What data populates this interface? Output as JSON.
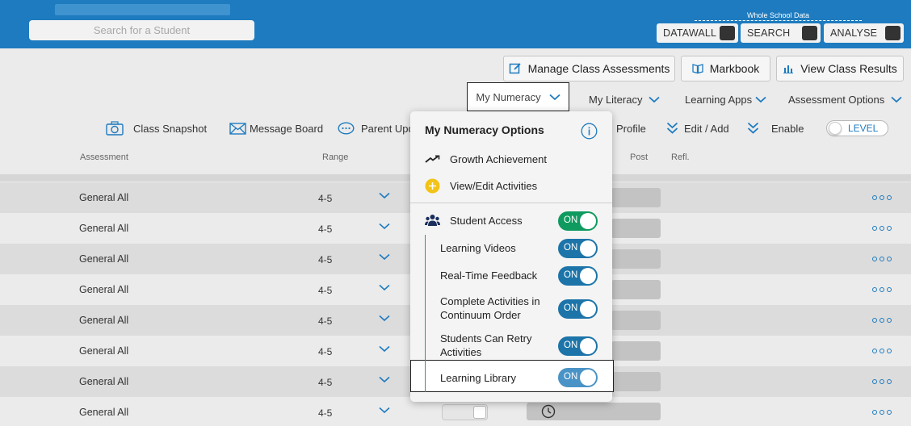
{
  "header": {
    "search_placeholder": "Search for a Student",
    "whole_school_label": "Whole School Data",
    "pills": [
      {
        "label": "DATAWALL"
      },
      {
        "label": "SEARCH"
      },
      {
        "label": "ANALYSE"
      }
    ]
  },
  "actions": {
    "manage": "Manage Class Assessments",
    "markbook": "Markbook",
    "results": "View Class Results"
  },
  "tabs": {
    "numeracy": "My Numeracy",
    "literacy": "My Literacy",
    "apps": "Learning Apps",
    "options": "Assessment Options"
  },
  "toolbar": {
    "snapshot": "Class Snapshot",
    "message": "Message Board",
    "parent": "Parent Upda",
    "profile": "Profile",
    "edit": "Edit / Add",
    "enable": "Enable",
    "level": "LEVEL"
  },
  "table": {
    "headers": {
      "assessment": "Assessment",
      "range": "Range",
      "post": "Post",
      "refl": "Refl."
    },
    "rows": [
      {
        "assessment": "General All",
        "range": "4-5"
      },
      {
        "assessment": "General All",
        "range": "4-5"
      },
      {
        "assessment": "General All",
        "range": "4-5"
      },
      {
        "assessment": "General All",
        "range": "4-5"
      },
      {
        "assessment": "General All",
        "range": "4-5"
      },
      {
        "assessment": "General All",
        "range": "4-5"
      },
      {
        "assessment": "General All",
        "range": "4-5"
      },
      {
        "assessment": "General All",
        "range": "4-5"
      }
    ]
  },
  "dropdown": {
    "title": "My Numeracy Options",
    "growth": "Growth Achievement",
    "view_edit": "View/Edit Activities",
    "student_access": "Student Access",
    "student_access_state": "ON",
    "learning_videos": "Learning Videos",
    "learning_videos_state": "ON",
    "realtime": "Real-Time Feedback",
    "realtime_state": "ON",
    "complete_1": "Complete Activities in",
    "complete_2": "Continuum Order",
    "complete_state": "ON",
    "retry_1": "Students Can Retry",
    "retry_2": "Activities",
    "retry_state": "ON",
    "library": "Learning Library",
    "library_state": "ON"
  },
  "colors": {
    "brand_blue": "#1e7bbf",
    "toggle_green": "#0f9a5f",
    "toggle_blue": "#1c74a9"
  }
}
